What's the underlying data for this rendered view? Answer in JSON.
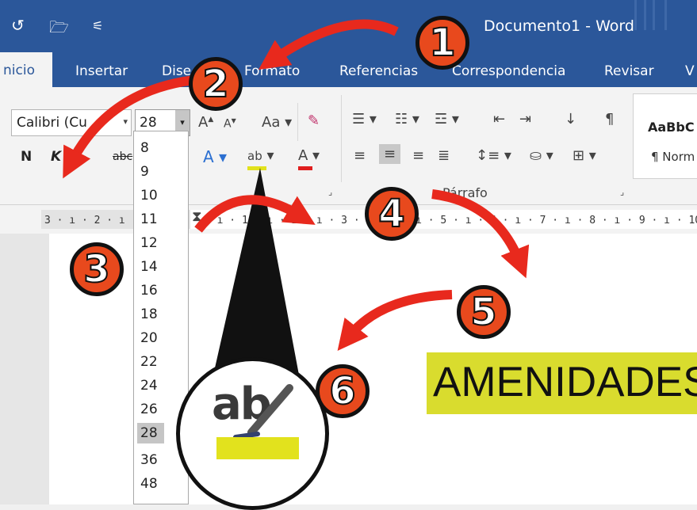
{
  "window": {
    "title": "Documento1  -  Word"
  },
  "quick_access": {
    "undo_icon": "undo-icon",
    "open_icon": "folder-open-icon",
    "customize_icon": "customize-qat-icon"
  },
  "tabs": [
    {
      "label": "nicio"
    },
    {
      "label": "Insertar"
    },
    {
      "label": "Dise"
    },
    {
      "label": "Formato"
    },
    {
      "label": "Referencias"
    },
    {
      "label": "Correspondencia"
    },
    {
      "label": "Revisar"
    },
    {
      "label": "V"
    }
  ],
  "ribbon": {
    "font_name": "Calibri (Cu",
    "font_size": "28",
    "bold_label": "N",
    "italic_label": "K",
    "paragraph_group_label": "Párrafo",
    "change_case_label": "Aa",
    "style_preview": "AaBbC",
    "style_name": "¶ Norm",
    "strike_fragment": "abc"
  },
  "ruler": {
    "left_ticks": "3 · ı · 2 · ı",
    "right_ticks": "· ı · 1 · ı · 2 · ı · 3 · ı · 4 · ı · 5 · ı · 6 · ı · 7 · ı · 8 · ı · 9 · ı · 10 ·"
  },
  "font_size_dropdown": {
    "options": [
      "8",
      "9",
      "10",
      "11",
      "12",
      "14",
      "16",
      "18",
      "20",
      "22",
      "24",
      "26",
      "28",
      "36",
      "48"
    ],
    "selected": "28"
  },
  "document": {
    "text": "AMENIDADES",
    "highlight_color": "#d9dc2e"
  },
  "magnifier": {
    "glyph_text": "ab",
    "highlight_color": "#e2e21d"
  },
  "badges": [
    "1",
    "2",
    "3",
    "4",
    "5",
    "6"
  ],
  "colors": {
    "word_blue": "#2b579a",
    "badge_orange": "#e8491d",
    "arrow_red": "#e8291d",
    "text_highlight": "#d9dc2e"
  }
}
